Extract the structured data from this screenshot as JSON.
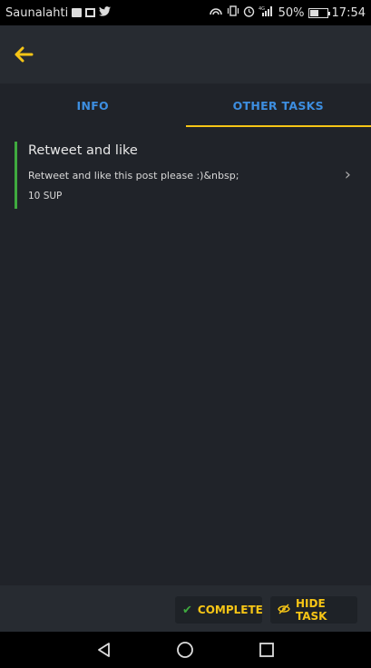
{
  "status_bar": {
    "carrier": "Saunalahti",
    "network": "4G",
    "battery": "50%",
    "battery_level": 0.5,
    "time": "17:54"
  },
  "app_bar": {
    "back_icon": "arrow-left-icon"
  },
  "tabs": [
    {
      "label": "INFO",
      "active": false
    },
    {
      "label": "OTHER TASKS",
      "active": true
    }
  ],
  "task": {
    "title": "Retweet and like",
    "description": "Retweet and like this post please :)&nbsp;",
    "reward": "10 SUP"
  },
  "actions": {
    "complete_label": "COMPLETE",
    "hide_label": "HIDE TASK"
  },
  "colors": {
    "accent": "#f6c516",
    "tab_text": "#3d8ee0",
    "status_green": "#3faa3f",
    "background": "#202329",
    "bar": "#272b31"
  }
}
